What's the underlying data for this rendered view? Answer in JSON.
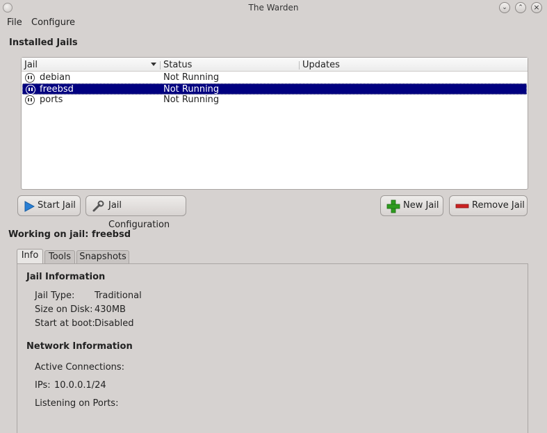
{
  "window": {
    "title": "The Warden"
  },
  "menu": {
    "file": "File",
    "configure": "Configure"
  },
  "installed_jails_title": "Installed Jails",
  "table": {
    "columns": [
      "Jail",
      "Status",
      "Updates"
    ],
    "rows": [
      {
        "name": "debian",
        "status": "Not Running",
        "updates": ""
      },
      {
        "name": "freebsd",
        "status": "Not Running",
        "updates": ""
      },
      {
        "name": "ports",
        "status": "Not Running",
        "updates": ""
      }
    ],
    "selected_row": "freebsd"
  },
  "buttons": {
    "start": "Start Jail",
    "config": "Jail Configuration",
    "new": "New Jail",
    "remove": "Remove Jail"
  },
  "working_on": "Working on jail: freebsd",
  "tabs": [
    "Info",
    "Tools",
    "Snapshots"
  ],
  "info": {
    "jail_info_title": "Jail Information",
    "type_label": "Jail Type:",
    "type_value": "Traditional",
    "size_label": "Size on Disk:",
    "size_value": "430MB",
    "boot_label": "Start at boot:",
    "boot_value": "Disabled",
    "network_title": "Network Information",
    "connections_label": "Active Connections:",
    "ips_label": "IPs:",
    "ips_value": "10.0.0.1/24",
    "ports_label": "Listening on Ports:"
  },
  "colors": {
    "selection": "#000080",
    "window_bg": "#d6d2d0",
    "new_icon": "#2e9b1f",
    "remove_icon": "#cc2222",
    "start_icon": "#2a7fd4"
  },
  "icons": [
    "window-menu-icon",
    "minimize-icon",
    "maximize-icon",
    "close-icon",
    "pause-icon",
    "play-icon",
    "wrench-icon",
    "plus-icon",
    "minus-icon"
  ]
}
